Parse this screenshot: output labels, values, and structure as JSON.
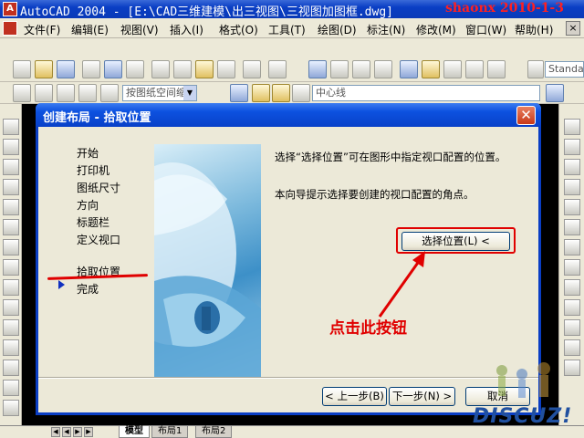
{
  "window": {
    "title": "AutoCAD 2004 - [E:\\CAD三维建模\\出三视图\\三视图加图框.dwg]",
    "watermark": "shaonx 2010-1-3"
  },
  "menubar": {
    "items": [
      "文件(F)",
      "编辑(E)",
      "视图(V)",
      "插入(I)",
      "格式(O)",
      "工具(T)",
      "绘图(D)",
      "标注(N)",
      "修改(M)",
      "窗口(W)",
      "帮助(H)"
    ],
    "close": "×"
  },
  "toolbar": {
    "text_style": "Standard",
    "viewport_scale": "按图纸空间缩",
    "layer": "中心线"
  },
  "dialog": {
    "title": "创建布局 - 拾取位置",
    "close": "✕",
    "steps": [
      "开始",
      "打印机",
      "图纸尺寸",
      "方向",
      "标题栏",
      "定义视口",
      "拾取位置",
      "完成"
    ],
    "current_step_index": 6,
    "description": "选择“选择位置”可在图形中指定视口配置的位置。",
    "hint": "本向导提示选择要创建的视口配置的角点。",
    "select_button": "选择位置(L) <",
    "prev_button": "< 上一步(B)",
    "next_button": "下一步(N) >",
    "cancel_button": "取消"
  },
  "annotation": {
    "text": "点击此按钮",
    "color": "#e00000"
  },
  "tabs": {
    "items": [
      "模型",
      "布局1",
      "布局2"
    ],
    "active": "模型"
  },
  "logo": {
    "text": "DISCUZ!"
  }
}
